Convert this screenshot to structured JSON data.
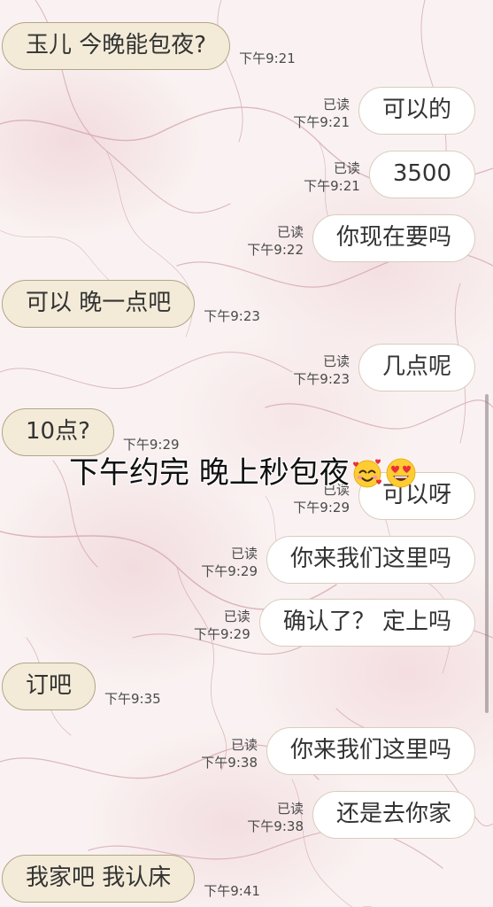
{
  "colors": {
    "received_bubble": "#f3ebd8",
    "received_border": "#b3a588",
    "sent_bubble": "#ffffff",
    "sent_border": "#d8cdbd",
    "text": "#333333",
    "meta": "#4a4a4a",
    "caption": "#111111",
    "background": "#faf2f2"
  },
  "messages": [
    {
      "text": "玉儿 今晚能包夜?",
      "time": "下午9:21"
    },
    {
      "text": "可以的",
      "status": "已读",
      "time": "下午9:21"
    },
    {
      "text": "3500",
      "status": "已读",
      "time": "下午9:21"
    },
    {
      "text": "你现在要吗",
      "status": "已读",
      "time": "下午9:22"
    },
    {
      "text": "可以 晚一点吧",
      "time": "下午9:23"
    },
    {
      "text": "几点呢",
      "status": "已读",
      "time": "下午9:23"
    },
    {
      "text": "10点?",
      "time": "下午9:29"
    },
    {
      "text": "可以呀",
      "status": "已读",
      "time": "下午9:29"
    },
    {
      "text": "你来我们这里吗",
      "status": "已读",
      "time": "下午9:29"
    },
    {
      "text": "确认了？ 定上吗",
      "status": "已读",
      "time": "下午9:29"
    },
    {
      "text": "订吧",
      "time": "下午9:35"
    },
    {
      "text": "你来我们这里吗",
      "status": "已读",
      "time": "下午9:38"
    },
    {
      "text": "还是去你家",
      "status": "已读",
      "time": "下午9:38"
    },
    {
      "text": "我家吧 我认床",
      "time": "下午9:41"
    }
  ],
  "overlay": {
    "caption": "下午约完 晚上秒包夜",
    "emojis": [
      "smiling-face-with-hearts-icon",
      "smiling-face-with-heart-eyes-icon"
    ]
  }
}
